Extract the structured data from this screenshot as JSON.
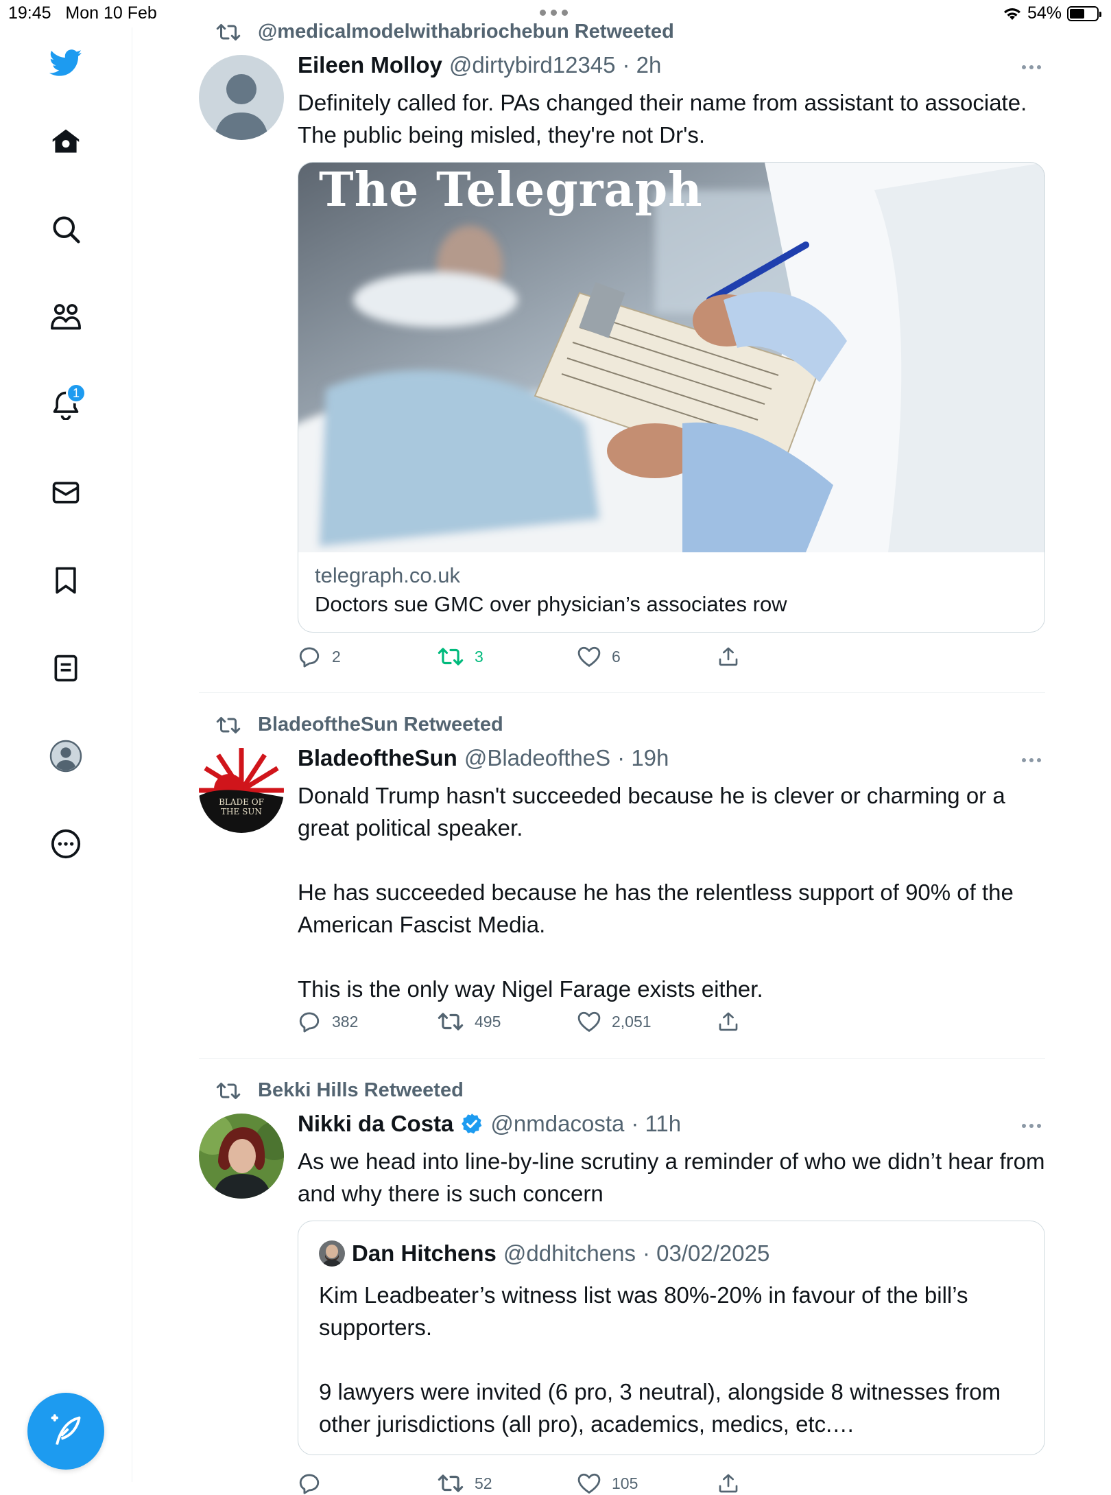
{
  "status_bar": {
    "time": "19:45",
    "date": "Mon 10 Feb",
    "battery": "54%",
    "battery_level": 0.54
  },
  "sidebar": {
    "items": [
      {
        "name": "home",
        "icon": "home-icon"
      },
      {
        "name": "explore",
        "icon": "search-icon"
      },
      {
        "name": "communities",
        "icon": "communities-icon"
      },
      {
        "name": "notifications",
        "icon": "bell-icon",
        "badge": "1"
      },
      {
        "name": "messages",
        "icon": "mail-icon"
      },
      {
        "name": "bookmarks",
        "icon": "bookmark-icon"
      },
      {
        "name": "lists",
        "icon": "list-icon"
      },
      {
        "name": "profile",
        "icon": "avatar-icon"
      },
      {
        "name": "more",
        "icon": "more-circle-icon"
      }
    ],
    "compose_icon": "compose-icon",
    "brand_color": "#1d9bf0"
  },
  "feed": {
    "tweets": [
      {
        "retweeted_by": "@medicalmodelwithabriochebun Retweeted",
        "name": "Eileen Molloy",
        "handle": "@dirtybird12345",
        "time": "· 2h",
        "text": "Definitely called for. PAs changed their name from assistant to associate. The public being misled, they're not Dr's.",
        "card": {
          "masthead": "The Telegraph",
          "domain": "telegraph.co.uk",
          "title": "Doctors sue GMC over physician’s associates row"
        },
        "replies": "2",
        "retweets": "3",
        "likes": "6"
      },
      {
        "retweeted_by": "BladeoftheSun Retweeted",
        "name": "BladeoftheSun",
        "handle": "@BladeoftheS",
        "time": "· 19h",
        "avatar_text": "BLADE OF THE SUN",
        "text": "Donald Trump hasn't succeeded because he is clever or charming or a great political speaker.\n\nHe has succeeded because he has the relentless support of 90% of the American Fascist Media.\n\nThis is the only way Nigel Farage exists either.",
        "replies": "382",
        "retweets": "495",
        "likes": "2,051"
      },
      {
        "retweeted_by": "Bekki Hills Retweeted",
        "name": "Nikki da Costa",
        "handle": "@nmdacosta",
        "time": "· 11h",
        "verified": true,
        "text": "As we head into line-by-line scrutiny a reminder of who we didn’t hear from and why there is such concern",
        "quote": {
          "name": "Dan Hitchens",
          "handle": "@ddhitchens",
          "time": "· 03/02/2025",
          "text": "Kim Leadbeater’s witness list was 80%-20% in favour of the bill’s supporters.\n\n9 lawyers were invited (6 pro, 3 neutral), alongside 8 witnesses from other jurisdictions (all pro), academics, medics, etc.…"
        },
        "replies": "",
        "retweets": "52",
        "likes": "105"
      }
    ]
  }
}
